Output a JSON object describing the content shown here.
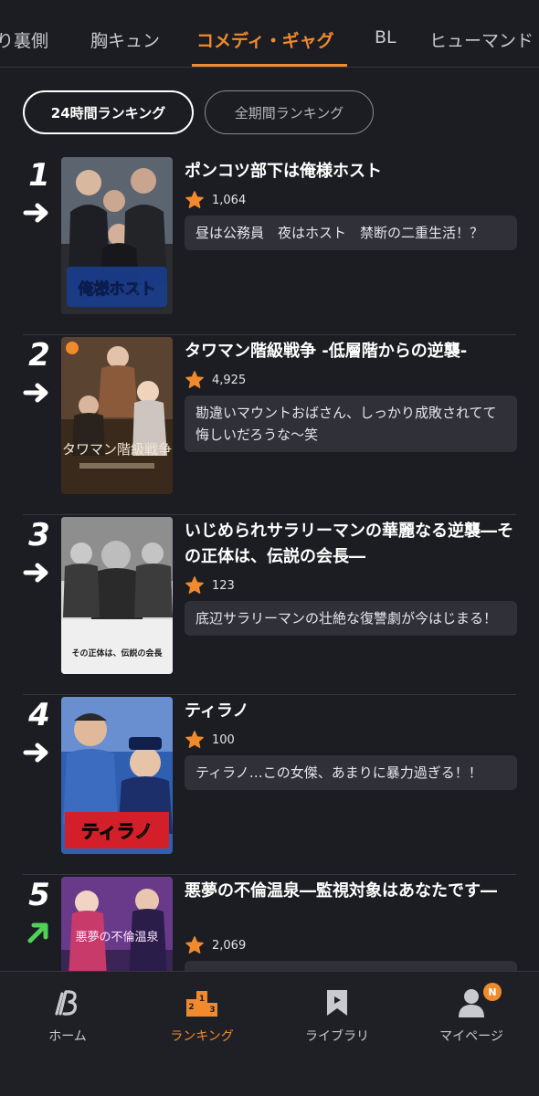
{
  "tabs": [
    {
      "label": "り裏側",
      "active": false
    },
    {
      "label": "胸キュン",
      "active": false
    },
    {
      "label": "コメディ・ギャグ",
      "active": true
    },
    {
      "label": "BL",
      "active": false
    },
    {
      "label": "ヒューマンド",
      "active": false
    }
  ],
  "ranking_toggle": {
    "active": "24時間ランキング",
    "inactive": "全期間ランキング"
  },
  "items": [
    {
      "rank": "1",
      "trend": "same",
      "title": "ポンコツ部下は俺様ホスト",
      "count": "1,064",
      "desc": "昼は公務員　夜はホスト　禁断の二重生活！？",
      "poster_caption": "俺様ホスト"
    },
    {
      "rank": "2",
      "trend": "same",
      "title": "タワマン階級戦争 -低層階からの逆襲-",
      "count": "4,925",
      "desc": "勘違いマウントおばさん、しっかり成敗されてて悔しいだろうな〜笑",
      "poster_caption": "タワマン階級戦争"
    },
    {
      "rank": "3",
      "trend": "same",
      "title": "いじめられサラリーマンの華麗なる逆襲―その正体は、伝説の会長―",
      "count": "123",
      "desc": "底辺サラリーマンの壮絶な復讐劇が今はじまる！",
      "poster_caption": "その正体は、伝説の会長"
    },
    {
      "rank": "4",
      "trend": "same",
      "title": "ティラノ",
      "count": "100",
      "desc": "ティラノ…この女傑、あまりに暴力過ぎる！！",
      "poster_caption": "ティラノ"
    },
    {
      "rank": "5",
      "trend": "up",
      "title": "悪夢の不倫温泉―監視対象はあなたです―",
      "count": "2,069",
      "desc": "",
      "poster_caption": "悪夢の不倫温泉"
    }
  ],
  "bottom_nav": [
    {
      "label": "ホーム",
      "icon": "home-logo-icon",
      "active": false
    },
    {
      "label": "ランキング",
      "icon": "podium-icon",
      "active": true
    },
    {
      "label": "ライブラリ",
      "icon": "bookmark-icon",
      "active": false
    },
    {
      "label": "マイページ",
      "icon": "user-icon",
      "active": false,
      "badge": "N"
    }
  ],
  "colors": {
    "accent": "#f08a2c",
    "background": "#1c1d22",
    "card": "#2f3038",
    "trend_up": "#4fd15a"
  }
}
